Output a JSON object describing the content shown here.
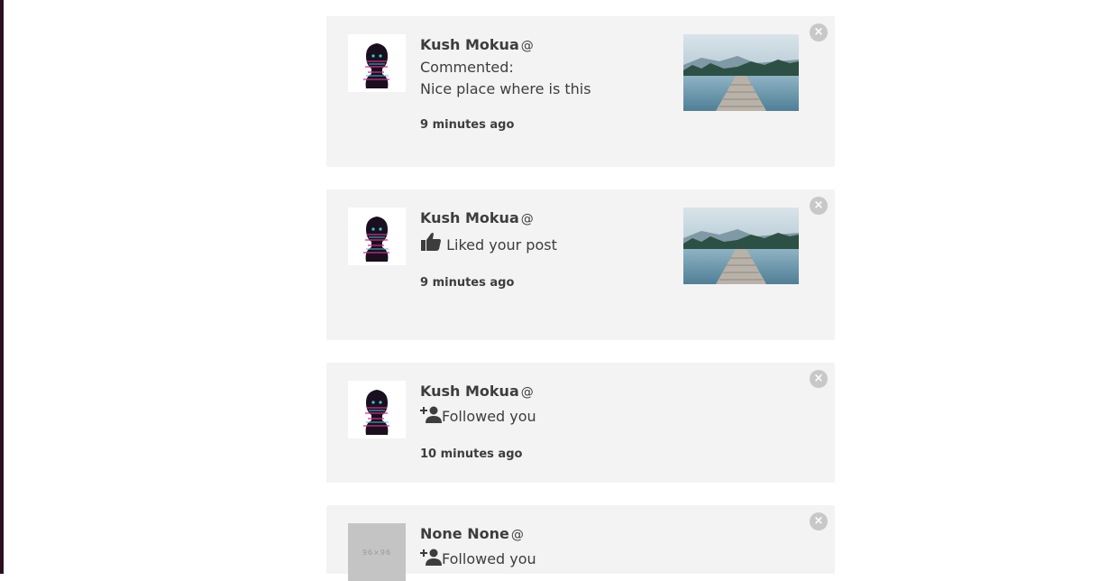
{
  "notifications": [
    {
      "name": "Kush Mokua",
      "at": "@",
      "action_prefix": "Commented:",
      "comment": "Nice place where is this",
      "time": "9 minutes ago",
      "close": "×"
    },
    {
      "name": "Kush Mokua",
      "at": "@",
      "action": "Liked your post",
      "icon": "thumbs-up-icon",
      "time": "9 minutes ago",
      "close": "×"
    },
    {
      "name": "Kush Mokua",
      "at": "@",
      "action": "Followed you",
      "icon": "add-person-icon",
      "time": "10 minutes ago",
      "close": "×"
    },
    {
      "name": "None None",
      "at": "@",
      "action": "Followed you",
      "icon": "add-person-icon",
      "placeholder_avatar_text": "96×96",
      "close": "×"
    }
  ]
}
